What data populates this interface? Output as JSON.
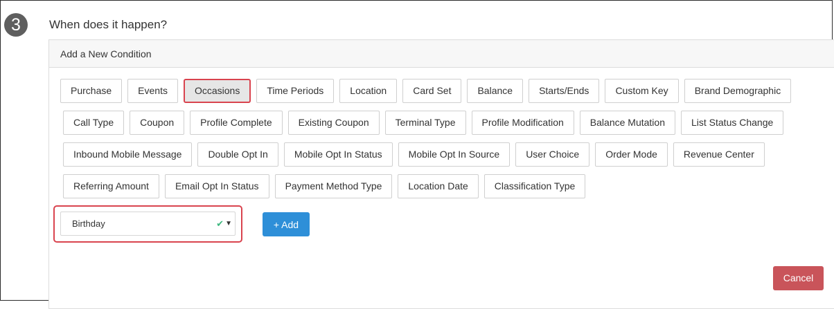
{
  "step": {
    "number": "3",
    "title": "When does it happen?"
  },
  "panel": {
    "header": "Add a New Condition"
  },
  "condition_types": {
    "row1": [
      "Purchase",
      "Events",
      "Occasions",
      "Time Periods",
      "Location",
      "Card Set",
      "Balance",
      "Starts/Ends",
      "Custom Key",
      "Brand Demographic"
    ],
    "row2": [
      "Call Type",
      "Coupon",
      "Profile Complete",
      "Existing Coupon",
      "Terminal Type",
      "Profile Modification",
      "Balance Mutation",
      "List Status Change"
    ],
    "row3": [
      "Inbound Mobile Message",
      "Double Opt In",
      "Mobile Opt In Status",
      "Mobile Opt In Source",
      "User Choice",
      "Order Mode",
      "Revenue Center"
    ],
    "row4": [
      "Referring Amount",
      "Email Opt In Status",
      "Payment Method Type",
      "Location Date",
      "Classification Type"
    ],
    "selected": "Occasions"
  },
  "occasion_select": {
    "value": "Birthday",
    "check_icon": "check-icon",
    "chevron_icon": "chevron-down-icon"
  },
  "buttons": {
    "add": "+ Add",
    "cancel": "Cancel"
  },
  "colors": {
    "highlight": "#d9434e",
    "primary": "#2e8fd8",
    "danger": "#c9545a",
    "check": "#3cb77e"
  }
}
